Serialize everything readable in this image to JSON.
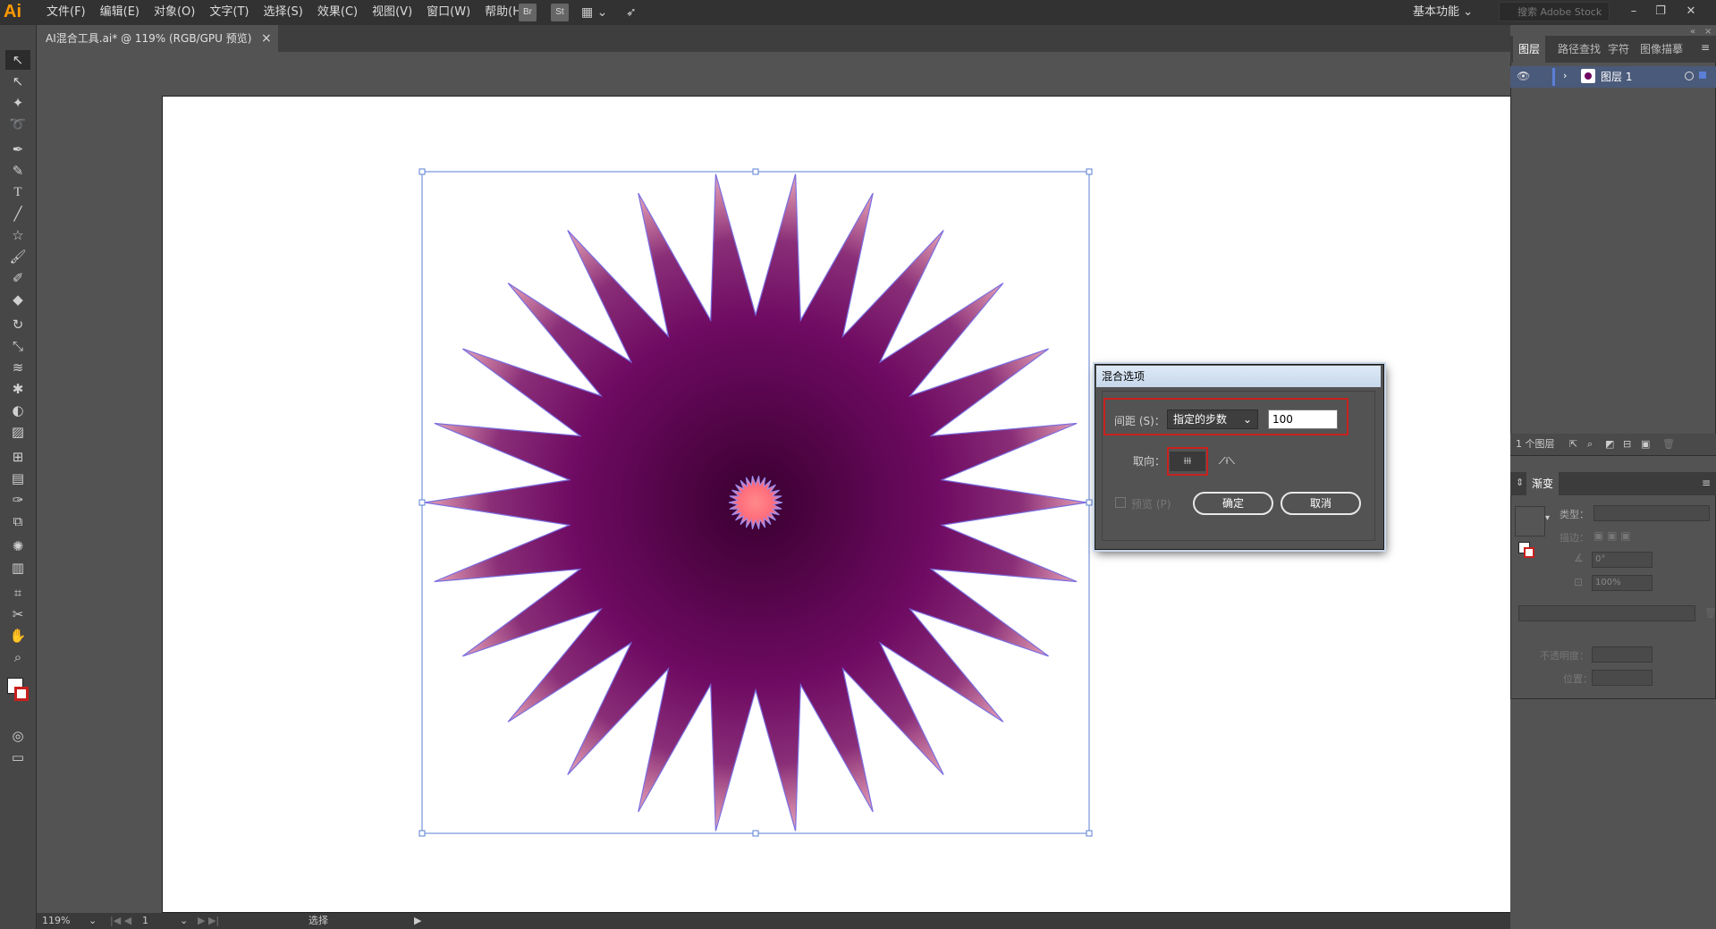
{
  "app": {
    "logo": "Ai",
    "accent": "#ff9a00"
  },
  "menu": [
    "文件(F)",
    "编辑(E)",
    "对象(O)",
    "文字(T)",
    "选择(S)",
    "效果(C)",
    "视图(V)",
    "窗口(W)",
    "帮助(H)"
  ],
  "toolbar": {
    "br": "Br",
    "st": "St"
  },
  "workspace": {
    "label": "基本功能"
  },
  "search": {
    "placeholder": "搜索 Adobe Stock"
  },
  "document": {
    "tab_title": "AI混合工具.ai* @ 119% (RGB/GPU 预览)"
  },
  "layers": {
    "tabs": [
      "图层",
      "路径查找",
      "字符",
      "图像描摹"
    ],
    "items": [
      {
        "name": "图层 1"
      }
    ],
    "footer": "1 个图层"
  },
  "gradient": {
    "title": "渐变",
    "type_label": "类型：",
    "stroke_label": "描边：",
    "angle_value": "0°",
    "aspect_value": "100%",
    "opacity_label": "不透明度：",
    "location_label": "位置："
  },
  "dialog": {
    "title": "混合选项",
    "spacing_label": "间距 (S)：",
    "spacing_value": "指定的步数",
    "steps_value": "100",
    "orientation_label": "取向：",
    "preview_label": "预览 (P)",
    "ok_label": "确定",
    "cancel_label": "取消"
  },
  "status": {
    "zoom": "119%",
    "page": "1",
    "tool": "选择"
  },
  "colors": {
    "star_outer": "#e6a0b4",
    "star_mid": "#6e0a62",
    "star_center": "#3a0030",
    "small_star": "#ff6a7a",
    "highlight": "#c8201e"
  }
}
